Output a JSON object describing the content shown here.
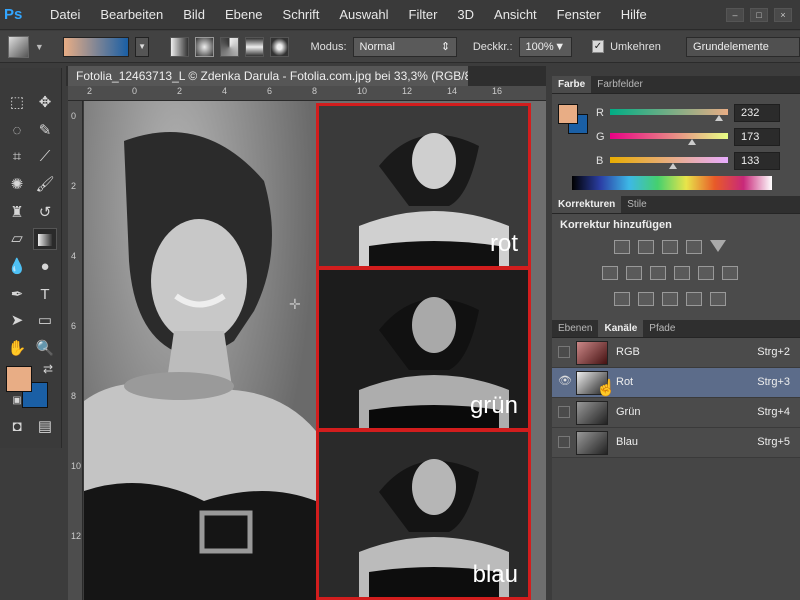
{
  "menubar": {
    "logo": "Ps",
    "items": [
      "Datei",
      "Bearbeiten",
      "Bild",
      "Ebene",
      "Schrift",
      "Auswahl",
      "Filter",
      "3D",
      "Ansicht",
      "Fenster",
      "Hilfe"
    ],
    "window_controls": [
      "–",
      "□",
      "×"
    ]
  },
  "options": {
    "mode_label": "Modus:",
    "mode_value": "Normal",
    "opacity_label": "Deckkr.:",
    "opacity_value": "100%",
    "reverse_label": "Umkehren",
    "workspace": "Grundelemente",
    "reverse_checked": true
  },
  "document": {
    "tab_title": "Fotolia_12463713_L © Zdenka Darula - Fotolia.com.jpg bei 33,3% (RGB/8#)",
    "close": "×",
    "ruler_top": [
      "2",
      "0",
      "2",
      "4",
      "6",
      "8",
      "10",
      "12",
      "14",
      "16",
      "18",
      "20"
    ],
    "ruler_left": [
      "0",
      "2",
      "4",
      "6",
      "8",
      "10",
      "12"
    ],
    "panels": [
      {
        "label": "rot"
      },
      {
        "label": "grün"
      },
      {
        "label": "blau"
      }
    ]
  },
  "color_panel": {
    "tabs": [
      "Farbe",
      "Farbfelder"
    ],
    "channels": [
      {
        "label": "R",
        "value": "232",
        "level": 0.91
      },
      {
        "label": "G",
        "value": "173",
        "level": 0.68
      },
      {
        "label": "B",
        "value": "133",
        "level": 0.52
      }
    ],
    "fg": "#e8ad85",
    "bg": "#1a5fa5"
  },
  "corrections_panel": {
    "tabs": [
      "Korrekturen",
      "Stile"
    ],
    "title": "Korrektur hinzufügen"
  },
  "channels_panel": {
    "tabs": [
      "Ebenen",
      "Kanäle",
      "Pfade"
    ],
    "rows": [
      {
        "name": "RGB",
        "shortcut": "Strg+2"
      },
      {
        "name": "Rot",
        "shortcut": "Strg+3"
      },
      {
        "name": "Grün",
        "shortcut": "Strg+4"
      },
      {
        "name": "Blau",
        "shortcut": "Strg+5"
      }
    ]
  }
}
